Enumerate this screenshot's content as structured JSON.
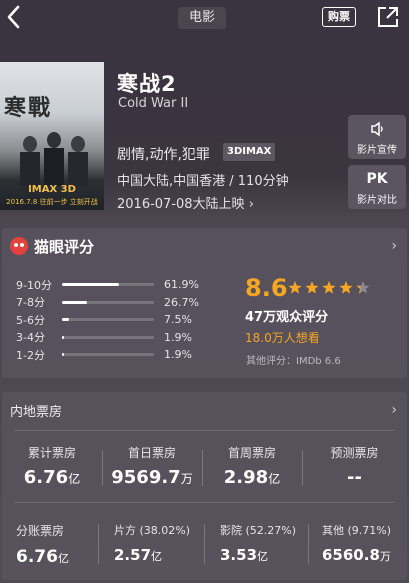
{
  "nav": {
    "title": "电影",
    "ticket_label": "购票"
  },
  "poster": {
    "title_text": "寒戰",
    "badge": "IMAX 3D",
    "date": "2016.7.8",
    "slogan": "往前一步 立刻开战"
  },
  "movie": {
    "name": "寒战2",
    "english_name": "Cold War II",
    "genres": "剧情,动作,犯罪",
    "format_tag": "3DIMAX",
    "region_duration": "中国大陆,中国香港 / 110分钟",
    "release": "2016-07-08大陆上映"
  },
  "side_buttons": [
    {
      "label": "影片宣传",
      "icon": "speaker-icon"
    },
    {
      "label": "影片对比",
      "icon_text": "PK"
    }
  ],
  "rating": {
    "title": "猫眼评分",
    "distribution": [
      {
        "label": "9-10分",
        "pct": "61.9%",
        "value": 61.9
      },
      {
        "label": "7-8分",
        "pct": "26.7%",
        "value": 26.7
      },
      {
        "label": "5-6分",
        "pct": "7.5%",
        "value": 7.5
      },
      {
        "label": "3-4分",
        "pct": "1.9%",
        "value": 1.9
      },
      {
        "label": "1-2分",
        "pct": "1.9%",
        "value": 1.9
      }
    ],
    "score": "8.6",
    "stars": 4.3,
    "audience": "47万观众评分",
    "want": "18.0万人想看",
    "other": "其他评分：IMDb 6.6",
    "accent": "#f5a623"
  },
  "box_office": {
    "title": "内地票房",
    "top": [
      {
        "label": "累计票房",
        "value": "6.76",
        "unit": "亿"
      },
      {
        "label": "首日票房",
        "value": "9569.7",
        "unit": "万"
      },
      {
        "label": "首周票房",
        "value": "2.98",
        "unit": "亿"
      },
      {
        "label": "预测票房",
        "value": "--",
        "unit": ""
      }
    ],
    "split": {
      "label": "分账票房",
      "value": "6.76",
      "unit": "亿",
      "parts": [
        {
          "label": "片方 (38.02%)",
          "value": "2.57",
          "unit": "亿"
        },
        {
          "label": "影院 (52.27%)",
          "value": "3.53",
          "unit": "亿"
        },
        {
          "label": "其他 (9.71%)",
          "value": "6560.8",
          "unit": "万"
        }
      ]
    }
  }
}
